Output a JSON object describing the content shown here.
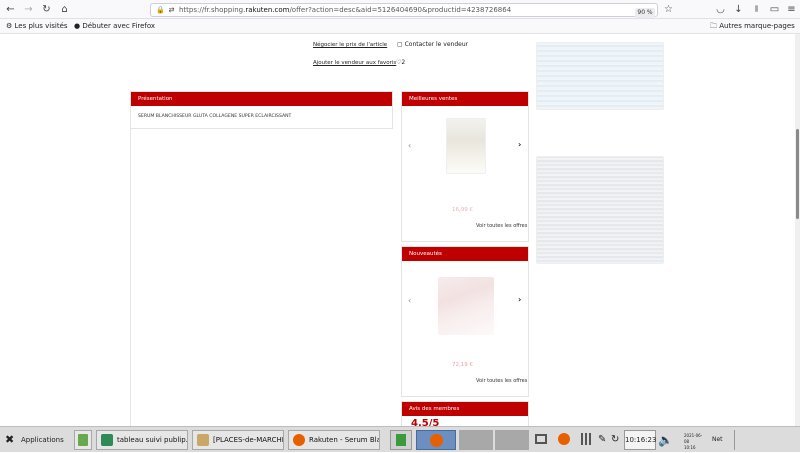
{
  "browser": {
    "url_prefix": "https://fr.shopping.",
    "url_domain": "rakuten.com",
    "url_suffix": "/offer?action=desc&aid=5126404690&productid=4238726864",
    "zoom": "90 %",
    "bookmarks": [
      "Les plus visités",
      "Débuter avec Firefox"
    ],
    "other_bookmarks": "Autres marque-pages"
  },
  "page": {
    "negotiate_link": "Négocier le prix de l'article",
    "contact_seller": "Contacter le vendeur",
    "add_seller_favorites": "Ajouter le vendeur aux favoris",
    "favorites_count": "2",
    "presentation_header": "Présentation",
    "presentation_text": "SERUM BLANCHISSEUR GLUTA COLLAGENE SUPER ECLAIRCISSANT",
    "best_sellers_header": "Meilleures ventes",
    "best_sellers_price": "16,99 €",
    "best_sellers_see_all": "Voir toutes les offres",
    "new_header": "Nouveautés",
    "new_price": "72,19 €",
    "new_see_all": "Voir toutes les offres",
    "reviews_header": "Avis des membres",
    "rating": "4,5/5"
  },
  "taskbar": {
    "applications": "Applications",
    "tasks": [
      "tableau suivi publip...",
      "[PLACES-de-MARCHE...",
      "Rakuten - Serum Bla..."
    ],
    "time": "10:16:23",
    "date_line1": "2021-06-08",
    "date_line2": "10:16",
    "network": "Net"
  },
  "colors": {
    "accent": "#bf0000",
    "taskbar": "#dcdcdc"
  }
}
